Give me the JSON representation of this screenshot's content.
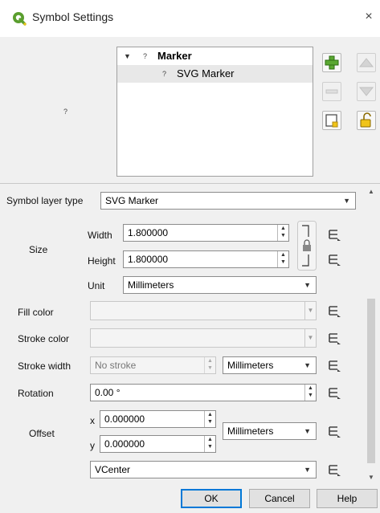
{
  "window": {
    "title": "Symbol Settings",
    "close_glyph": "×"
  },
  "preview": {
    "placeholder": "?"
  },
  "tree": {
    "items": [
      {
        "label": "Marker",
        "expanded": true,
        "bold": true
      },
      {
        "label": "SVG Marker",
        "selected": true
      }
    ],
    "qmark": "?"
  },
  "form": {
    "layer_type_label": "Symbol layer type",
    "layer_type_value": "SVG Marker",
    "size_label": "Size",
    "width_label": "Width",
    "width_value": "1.800000",
    "height_label": "Height",
    "height_value": "1.800000",
    "unit_label": "Unit",
    "unit_value": "Millimeters",
    "fill_color_label": "Fill color",
    "stroke_color_label": "Stroke color",
    "stroke_width_label": "Stroke width",
    "stroke_width_value": "No stroke",
    "stroke_width_unit": "Millimeters",
    "rotation_label": "Rotation",
    "rotation_value": "0.00 °",
    "offset_label": "Offset",
    "offset_x_label": "x",
    "offset_x_value": "0.000000",
    "offset_y_label": "y",
    "offset_y_value": "0.000000",
    "offset_unit": "Millimeters",
    "anchor_value": "VCenter"
  },
  "buttons": {
    "ok": "OK",
    "cancel": "Cancel",
    "help": "Help"
  },
  "colors": {
    "accent": "#0078d7",
    "qgis_green": "#5a9e2e",
    "qgis_yellow": "#f0c419"
  }
}
